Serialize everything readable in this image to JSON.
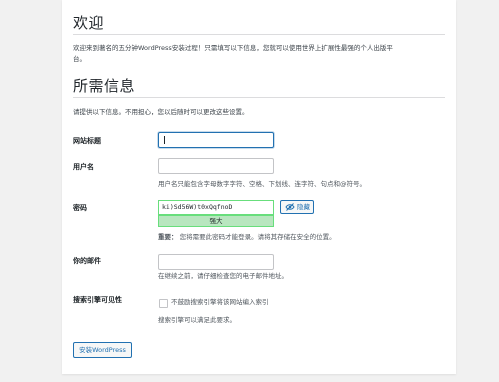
{
  "welcome": {
    "heading": "欢迎",
    "intro_line1": "欢迎来到著名的五分钟WordPress安装过程！只需填写以下信息，您就可以使用世界上扩展性最强的个人出版平",
    "intro_line2": "台。"
  },
  "info": {
    "heading": "所需信息",
    "intro": "请提供以下信息。不用担心，您以后随时可以更改这些设置。"
  },
  "fields": {
    "site_title": {
      "label": "网站标题",
      "value": ""
    },
    "username": {
      "label": "用户名",
      "value": "",
      "help": "用户名只能包含字母数字字符、空格、下划线、连字符、句点和@符号。"
    },
    "password": {
      "label": "密码",
      "value": "ki)Sd56W)t0xQqfnoD",
      "strength": "强大",
      "hide_label": "隐藏",
      "important_label": "重要：",
      "important_text": "您将需要此密码才能登录。请将其存储在安全的位置。"
    },
    "email": {
      "label": "你的邮件",
      "value": "",
      "help": "在继续之前，请仔细检查您的电子邮件地址。"
    },
    "search_visibility": {
      "label": "搜索引擎可见性",
      "checkbox_label": "不鼓励搜索引擎将该网站编入索引",
      "checked": false,
      "help": "搜索引擎可以满足此要求。"
    }
  },
  "install_button": "安装WordPress",
  "icons": {
    "hide": "eye-slash-icon"
  },
  "colors": {
    "accent": "#2271b1",
    "strength_bg": "#b8e6bf",
    "strength_border": "#68de7c"
  }
}
